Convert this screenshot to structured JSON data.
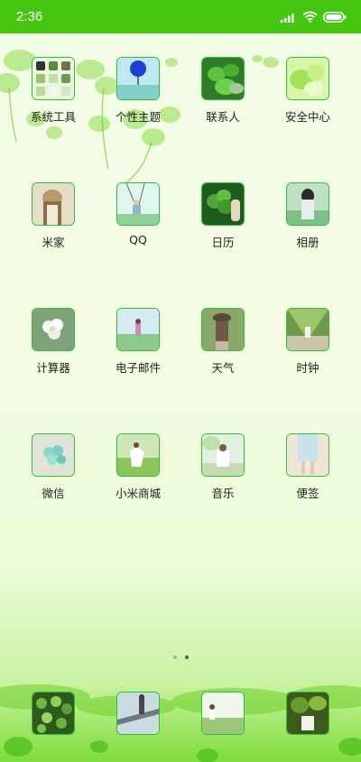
{
  "status_bar": {
    "time": "2:36"
  },
  "home": {
    "apps": [
      {
        "label": "系统工具",
        "icon": "system-tools-folder-icon"
      },
      {
        "label": "个性主题",
        "icon": "themes-icon"
      },
      {
        "label": "联系人",
        "icon": "contacts-icon"
      },
      {
        "label": "安全中心",
        "icon": "security-center-icon"
      },
      {
        "label": "米家",
        "icon": "mijia-icon"
      },
      {
        "label": "QQ",
        "icon": "qq-icon"
      },
      {
        "label": "日历",
        "icon": "calendar-icon"
      },
      {
        "label": "相册",
        "icon": "gallery-icon"
      },
      {
        "label": "计算器",
        "icon": "calculator-icon"
      },
      {
        "label": "电子邮件",
        "icon": "email-icon"
      },
      {
        "label": "天气",
        "icon": "weather-icon"
      },
      {
        "label": "时钟",
        "icon": "clock-icon"
      },
      {
        "label": "微信",
        "icon": "wechat-icon"
      },
      {
        "label": "小米商城",
        "icon": "mi-store-icon"
      },
      {
        "label": "音乐",
        "icon": "music-icon"
      },
      {
        "label": "便签",
        "icon": "notes-icon"
      }
    ],
    "page_indicator": {
      "count": 2,
      "active": 2
    }
  },
  "dock": {
    "apps": [
      {
        "icon": "phone-icon"
      },
      {
        "icon": "messages-icon"
      },
      {
        "icon": "browser-icon"
      },
      {
        "icon": "camera-icon"
      }
    ]
  },
  "colors": {
    "status_bar": "#45c712",
    "icon_border": "#2fbf3c",
    "wallpaper_green": "#7fdc3a"
  }
}
